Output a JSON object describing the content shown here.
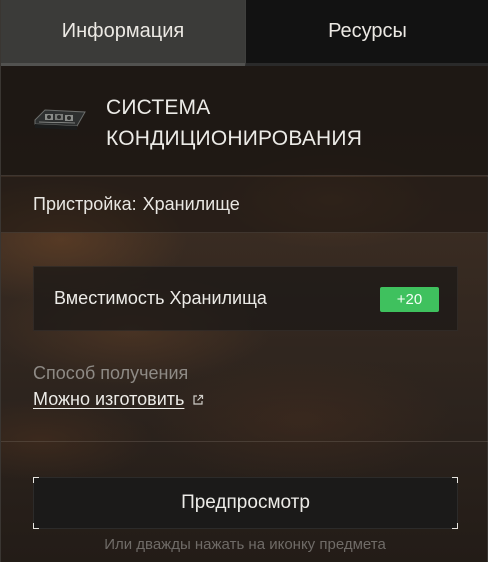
{
  "tabs": [
    {
      "label": "Информация",
      "active": true
    },
    {
      "label": "Ресурсы",
      "active": false
    }
  ],
  "item": {
    "icon": "air-conditioning-unit-icon",
    "title_line1": "СИСТЕМА",
    "title_line2": "КОНДИЦИОНИРОВАНИЯ"
  },
  "attachment": {
    "label": "Пристройка:",
    "value": "Хранилище"
  },
  "stat": {
    "name": "Вместимость Хранилища",
    "value": "+20",
    "badge_color": "#3fc15e"
  },
  "obtain": {
    "label": "Способ получения",
    "link": "Можно изготовить",
    "link_icon": "external-link-icon"
  },
  "preview": {
    "button_label": "Предпросмотр",
    "hint": "Или дважды нажать на иконку предмета"
  }
}
